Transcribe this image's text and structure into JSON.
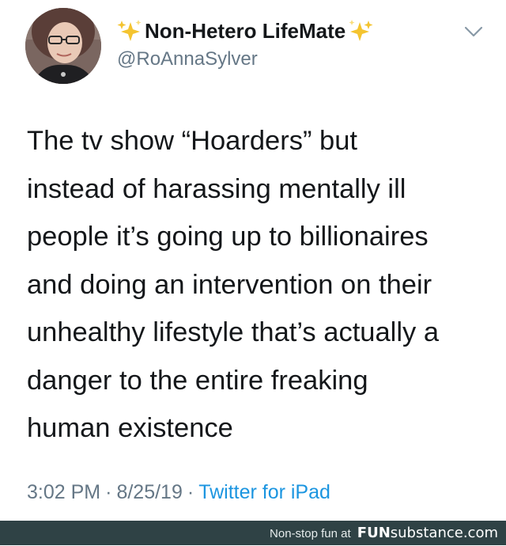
{
  "tweet": {
    "display_name": "Non-Hetero LifeMate",
    "handle": "@RoAnnaSylver",
    "text_lines": [
      "The tv show “Hoarders” but",
      "instead of harassing mentally ill",
      "people it’s going up to billionaires",
      "and doing an intervention on their",
      "unhealthy lifestyle that’s actually a",
      "danger to the entire freaking",
      "human existence"
    ],
    "time": "3:02 PM",
    "date": "8/25/19",
    "separator": "·",
    "source": "Twitter for iPad",
    "icons": {
      "sparkle_left": "sparkles-icon",
      "sparkle_right": "sparkles-icon",
      "menu": "chevron-down-icon"
    }
  },
  "footer": {
    "tagline": "Non-stop fun at",
    "brand_bold": "FUN",
    "brand_rest": "substance.com"
  },
  "colors": {
    "text": "#14171a",
    "secondary": "#657786",
    "link": "#1b95e0",
    "sparkle": "#f4c430",
    "footer_bg": "#2f4245"
  }
}
